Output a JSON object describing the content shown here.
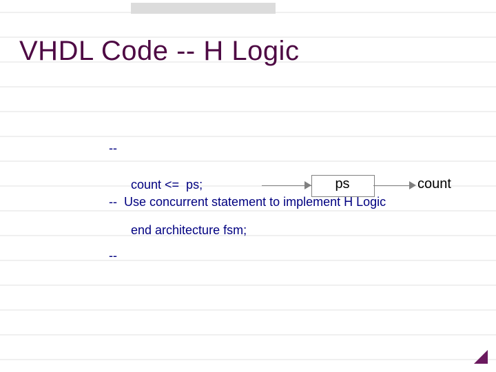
{
  "title": "VHDL Code  --  H Logic",
  "comments": {
    "l1": "--",
    "l2": "--  Use concurrent statement to implement H Logic",
    "l3": "--"
  },
  "code": {
    "count_assign": "count <=  ps;",
    "end_arch": "end architecture fsm;"
  },
  "diagram": {
    "input_label": "ps",
    "output_label": "count"
  }
}
